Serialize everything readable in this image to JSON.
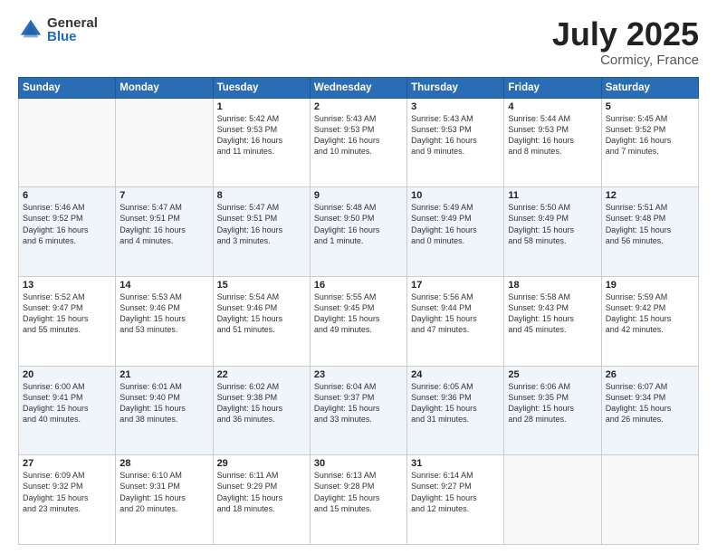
{
  "logo": {
    "general": "General",
    "blue": "Blue"
  },
  "title": {
    "month": "July 2025",
    "location": "Cormicy, France"
  },
  "days_header": [
    "Sunday",
    "Monday",
    "Tuesday",
    "Wednesday",
    "Thursday",
    "Friday",
    "Saturday"
  ],
  "weeks": [
    [
      {
        "day": "",
        "info": ""
      },
      {
        "day": "",
        "info": ""
      },
      {
        "day": "1",
        "info": "Sunrise: 5:42 AM\nSunset: 9:53 PM\nDaylight: 16 hours\nand 11 minutes."
      },
      {
        "day": "2",
        "info": "Sunrise: 5:43 AM\nSunset: 9:53 PM\nDaylight: 16 hours\nand 10 minutes."
      },
      {
        "day": "3",
        "info": "Sunrise: 5:43 AM\nSunset: 9:53 PM\nDaylight: 16 hours\nand 9 minutes."
      },
      {
        "day": "4",
        "info": "Sunrise: 5:44 AM\nSunset: 9:53 PM\nDaylight: 16 hours\nand 8 minutes."
      },
      {
        "day": "5",
        "info": "Sunrise: 5:45 AM\nSunset: 9:52 PM\nDaylight: 16 hours\nand 7 minutes."
      }
    ],
    [
      {
        "day": "6",
        "info": "Sunrise: 5:46 AM\nSunset: 9:52 PM\nDaylight: 16 hours\nand 6 minutes."
      },
      {
        "day": "7",
        "info": "Sunrise: 5:47 AM\nSunset: 9:51 PM\nDaylight: 16 hours\nand 4 minutes."
      },
      {
        "day": "8",
        "info": "Sunrise: 5:47 AM\nSunset: 9:51 PM\nDaylight: 16 hours\nand 3 minutes."
      },
      {
        "day": "9",
        "info": "Sunrise: 5:48 AM\nSunset: 9:50 PM\nDaylight: 16 hours\nand 1 minute."
      },
      {
        "day": "10",
        "info": "Sunrise: 5:49 AM\nSunset: 9:49 PM\nDaylight: 16 hours\nand 0 minutes."
      },
      {
        "day": "11",
        "info": "Sunrise: 5:50 AM\nSunset: 9:49 PM\nDaylight: 15 hours\nand 58 minutes."
      },
      {
        "day": "12",
        "info": "Sunrise: 5:51 AM\nSunset: 9:48 PM\nDaylight: 15 hours\nand 56 minutes."
      }
    ],
    [
      {
        "day": "13",
        "info": "Sunrise: 5:52 AM\nSunset: 9:47 PM\nDaylight: 15 hours\nand 55 minutes."
      },
      {
        "day": "14",
        "info": "Sunrise: 5:53 AM\nSunset: 9:46 PM\nDaylight: 15 hours\nand 53 minutes."
      },
      {
        "day": "15",
        "info": "Sunrise: 5:54 AM\nSunset: 9:46 PM\nDaylight: 15 hours\nand 51 minutes."
      },
      {
        "day": "16",
        "info": "Sunrise: 5:55 AM\nSunset: 9:45 PM\nDaylight: 15 hours\nand 49 minutes."
      },
      {
        "day": "17",
        "info": "Sunrise: 5:56 AM\nSunset: 9:44 PM\nDaylight: 15 hours\nand 47 minutes."
      },
      {
        "day": "18",
        "info": "Sunrise: 5:58 AM\nSunset: 9:43 PM\nDaylight: 15 hours\nand 45 minutes."
      },
      {
        "day": "19",
        "info": "Sunrise: 5:59 AM\nSunset: 9:42 PM\nDaylight: 15 hours\nand 42 minutes."
      }
    ],
    [
      {
        "day": "20",
        "info": "Sunrise: 6:00 AM\nSunset: 9:41 PM\nDaylight: 15 hours\nand 40 minutes."
      },
      {
        "day": "21",
        "info": "Sunrise: 6:01 AM\nSunset: 9:40 PM\nDaylight: 15 hours\nand 38 minutes."
      },
      {
        "day": "22",
        "info": "Sunrise: 6:02 AM\nSunset: 9:38 PM\nDaylight: 15 hours\nand 36 minutes."
      },
      {
        "day": "23",
        "info": "Sunrise: 6:04 AM\nSunset: 9:37 PM\nDaylight: 15 hours\nand 33 minutes."
      },
      {
        "day": "24",
        "info": "Sunrise: 6:05 AM\nSunset: 9:36 PM\nDaylight: 15 hours\nand 31 minutes."
      },
      {
        "day": "25",
        "info": "Sunrise: 6:06 AM\nSunset: 9:35 PM\nDaylight: 15 hours\nand 28 minutes."
      },
      {
        "day": "26",
        "info": "Sunrise: 6:07 AM\nSunset: 9:34 PM\nDaylight: 15 hours\nand 26 minutes."
      }
    ],
    [
      {
        "day": "27",
        "info": "Sunrise: 6:09 AM\nSunset: 9:32 PM\nDaylight: 15 hours\nand 23 minutes."
      },
      {
        "day": "28",
        "info": "Sunrise: 6:10 AM\nSunset: 9:31 PM\nDaylight: 15 hours\nand 20 minutes."
      },
      {
        "day": "29",
        "info": "Sunrise: 6:11 AM\nSunset: 9:29 PM\nDaylight: 15 hours\nand 18 minutes."
      },
      {
        "day": "30",
        "info": "Sunrise: 6:13 AM\nSunset: 9:28 PM\nDaylight: 15 hours\nand 15 minutes."
      },
      {
        "day": "31",
        "info": "Sunrise: 6:14 AM\nSunset: 9:27 PM\nDaylight: 15 hours\nand 12 minutes."
      },
      {
        "day": "",
        "info": ""
      },
      {
        "day": "",
        "info": ""
      }
    ]
  ]
}
